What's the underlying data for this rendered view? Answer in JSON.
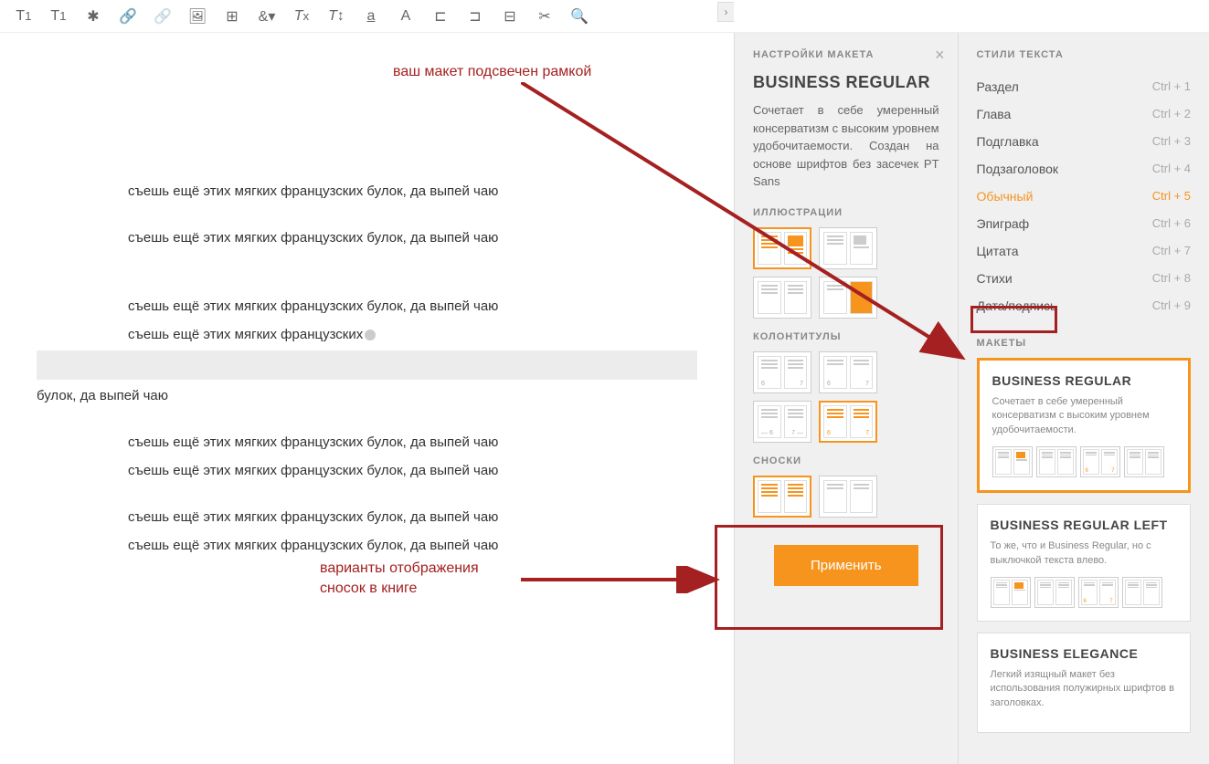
{
  "toolbar": {
    "icons": [
      "T₁",
      "T¹",
      "✱",
      "🔗",
      "ᵢ",
      "🖼",
      "⊞",
      "&",
      "Tx",
      "T↕",
      "a̲",
      "A",
      "⊏",
      "⊐",
      "⊟",
      "✂",
      "🔍"
    ]
  },
  "editor": {
    "line1": "съешь ещё этих мягких французских булок, да выпей чаю",
    "line2": "съешь ещё этих мягких французских булок, да выпей чаю",
    "line3": "съешь ещё этих мягких французских булок, да выпей чаю",
    "line4a": "съешь ещё этих мягких французских",
    "line4b": "булок, да выпей чаю",
    "line5": "съешь ещё этих мягких французских булок, да выпей чаю",
    "line6": "съешь ещё этих мягких французских булок, да выпей чаю",
    "line7": "съешь ещё этих мягких французских булок, да выпей чаю",
    "line8": "съешь ещё этих мягких французских булок, да выпей чаю"
  },
  "settings": {
    "header": "НАСТРОЙКИ МАКЕТА",
    "title": "BUSINESS REGULAR",
    "desc": "Сочетает в себе умеренный консерватизм с высоким уровнем удобочитаемости. Создан на основе шрифтов без засечек PT Sans",
    "illustrations": "ИЛЛЮСТРАЦИИ",
    "headers": "КОЛОНТИТУЛЫ",
    "footnotes": "СНОСКИ",
    "apply": "Применить"
  },
  "styles": {
    "header": "СТИЛИ ТЕКСТА",
    "items": [
      {
        "label": "Раздел",
        "key": "Ctrl + 1"
      },
      {
        "label": "Глава",
        "key": "Ctrl + 2"
      },
      {
        "label": "Подглавка",
        "key": "Ctrl + 3"
      },
      {
        "label": "Подзаголовок",
        "key": "Ctrl + 4"
      },
      {
        "label": "Обычный",
        "key": "Ctrl + 5"
      },
      {
        "label": "Эпиграф",
        "key": "Ctrl + 6"
      },
      {
        "label": "Цитата",
        "key": "Ctrl + 7"
      },
      {
        "label": "Стихи",
        "key": "Ctrl + 8"
      },
      {
        "label": "Дата/подпись",
        "key": "Ctrl + 9"
      }
    ],
    "makety": "МАКЕТЫ",
    "cards": [
      {
        "title": "BUSINESS REGULAR",
        "desc": "Сочетает в себе умеренный консерватизм с высоким уровнем удобочитаемости."
      },
      {
        "title": "BUSINESS REGULAR LEFT",
        "desc": "То же, что и Business Regular, но с выключкой текста влево."
      },
      {
        "title": "BUSINESS ELEGANCE",
        "desc": "Легкий изящный макет без использования полужирных шрифтов в заголовках."
      }
    ]
  },
  "annotations": {
    "top": "ваш макет подсвечен рамкой",
    "bottom1": "варианты отображения",
    "bottom2": "сносок в книге"
  }
}
